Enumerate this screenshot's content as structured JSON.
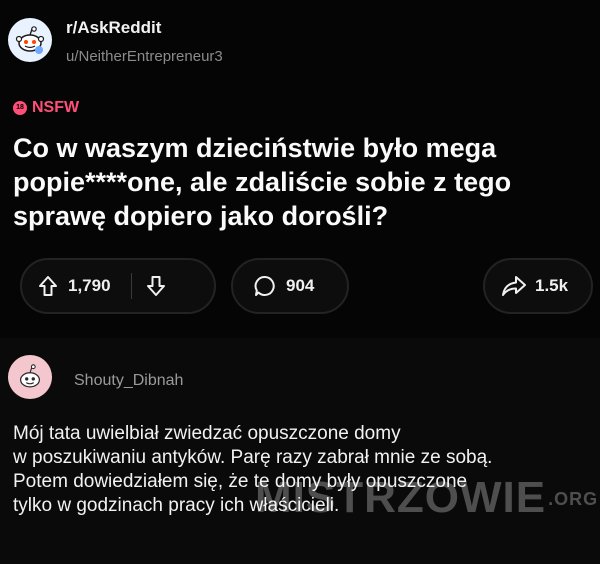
{
  "post": {
    "subreddit": "r/AskReddit",
    "author": "u/NeitherEntrepreneur3",
    "badge": "NSFW",
    "title": "Co w waszym dzieciństwie było mega popie****one, ale zdaliście sobie z tego sprawę dopiero jako dorośli?",
    "upvotes": "1,790",
    "comments": "904",
    "shares": "1.5k"
  },
  "comment": {
    "author": "Shouty_Dibnah",
    "lines": [
      "Mój tata uwielbiał zwiedzać opuszczone domy",
      "w poszukiwaniu antyków. Parę razy zabrał mnie ze sobą.",
      "Potem dowiedziałem się, że te domy były opuszczone",
      "tylko w godzinach pracy ich właścicieli."
    ]
  },
  "watermark": {
    "main": "MISTRZOWIE",
    "suffix": ".ORG"
  },
  "colors": {
    "background": "#000000",
    "nsfw": "#ff4f79",
    "muted": "#8b8b8b",
    "comment_avatar": "#f4c7cf",
    "subreddit_avatar": "#e9f2ff"
  },
  "icons": {
    "subreddit_avatar": "reddit-alien-icon",
    "nsfw": "nsfw-badge-icon",
    "upvote": "upvote-arrow-icon",
    "downvote": "downvote-arrow-icon",
    "comment": "comment-bubble-icon",
    "share": "share-arrow-icon",
    "comment_avatar": "reddit-alien-icon"
  }
}
